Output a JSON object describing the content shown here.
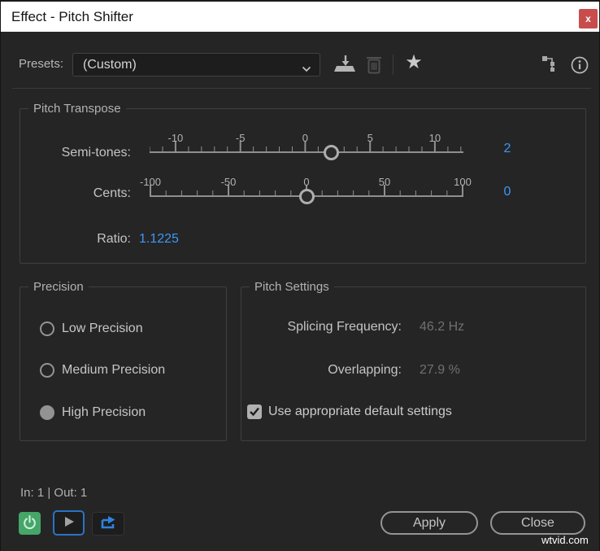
{
  "window": {
    "title": "Effect - Pitch Shifter",
    "close_glyph": "x"
  },
  "colors": {
    "accent_blue": "#3d97f6",
    "power_green": "#45a667",
    "close_red": "#c94c4c",
    "titlebar_bg": "#ffffff",
    "dialog_bg": "#252525"
  },
  "presets": {
    "label": "Presets:",
    "selected_value": "(Custom)",
    "favorite_glyph": "★",
    "icons": {
      "save": "save-preset-icon",
      "delete": "delete-preset-icon",
      "favorite": "favorite-star-icon",
      "channel_map": "channel-map-icon",
      "info": "info-icon"
    }
  },
  "pitch_transpose": {
    "legend": "Pitch Transpose",
    "semi_tones": {
      "label": "Semi-tones:",
      "value_display": "2",
      "slider": {
        "axis_min": -12,
        "axis_max": 12.2,
        "majors": [
          -10,
          -5,
          0,
          5,
          10
        ],
        "minor_step": 1,
        "value": 2
      }
    },
    "cents": {
      "label": "Cents:",
      "value_display": "0",
      "slider": {
        "axis_min": -100.5,
        "axis_max": 100.5,
        "majors": [
          -100,
          -50,
          0,
          50,
          100
        ],
        "minor_step": 10,
        "value": 0
      }
    },
    "ratio": {
      "label": "Ratio:",
      "value": "1.1225"
    }
  },
  "precision": {
    "legend": "Precision",
    "options": [
      {
        "label": "Low Precision",
        "selected": false
      },
      {
        "label": "Medium Precision",
        "selected": false
      },
      {
        "label": "High Precision",
        "selected": true
      }
    ]
  },
  "pitch_settings": {
    "legend": "Pitch Settings",
    "splicing_frequency": {
      "label": "Splicing Frequency:",
      "value": "46.2 Hz"
    },
    "overlapping": {
      "label": "Overlapping:",
      "value": "27.9 %"
    },
    "default_settings": {
      "label": "Use appropriate default settings",
      "checked": true
    }
  },
  "footer": {
    "io_status": "In: 1 | Out: 1",
    "apply_label": "Apply",
    "close_label": "Close"
  },
  "watermark": "wtvid.com"
}
